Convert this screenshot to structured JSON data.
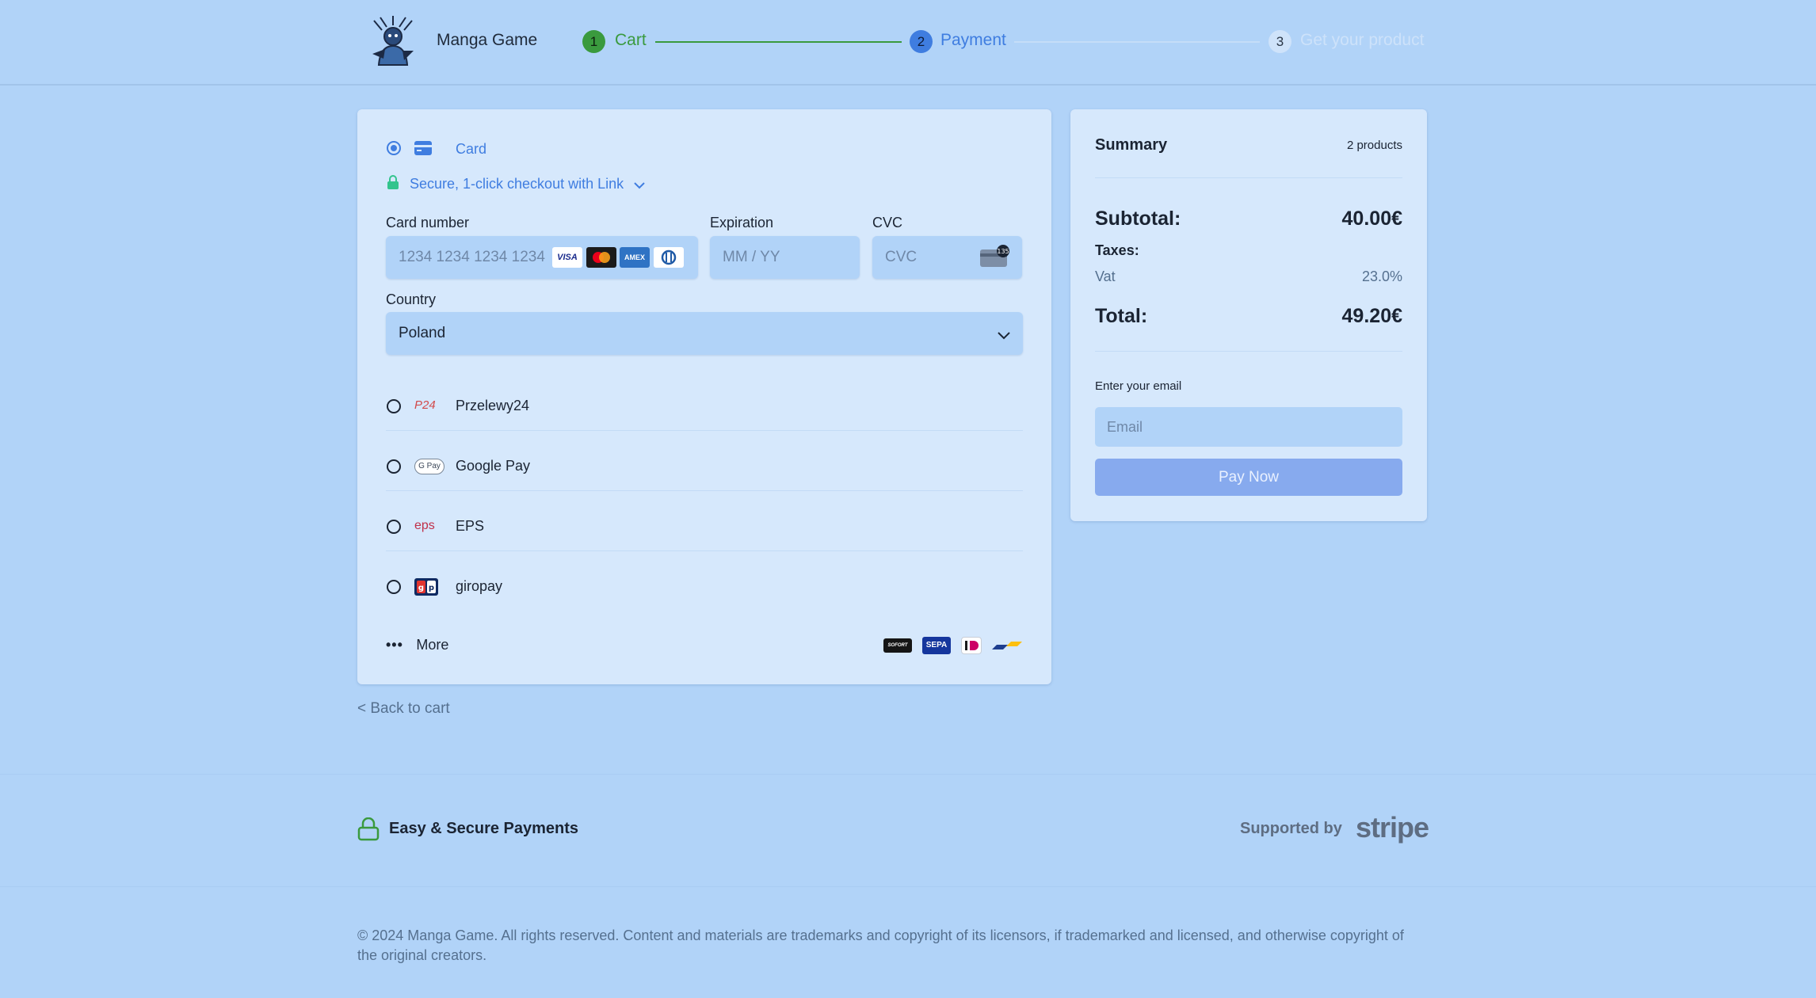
{
  "header": {
    "brand": "Manga Game",
    "steps": [
      {
        "number": "1",
        "label": "Cart",
        "color": "#3a9a3e"
      },
      {
        "number": "2",
        "label": "Payment",
        "color": "#3f7de0"
      },
      {
        "number": "3",
        "label": "Get your product",
        "color": "#d2e5fb"
      }
    ]
  },
  "payment": {
    "card_method_label": "Card",
    "link_text": "Secure, 1-click checkout with Link",
    "card_number_label": "Card number",
    "card_number_placeholder": "1234 1234 1234 1234",
    "card_brands": [
      "VISA",
      "MC",
      "AMEX",
      "DINERS"
    ],
    "expiration_label": "Expiration",
    "expiration_placeholder": "MM / YY",
    "cvc_label": "CVC",
    "cvc_placeholder": "CVC",
    "country_label": "Country",
    "country_value": "Poland",
    "methods": [
      {
        "label": "Przelewy24",
        "icon": "p24-icon"
      },
      {
        "label": "Google Pay",
        "icon": "gpay-icon"
      },
      {
        "label": "EPS",
        "icon": "eps-icon"
      },
      {
        "label": "giropay",
        "icon": "giropay-icon"
      }
    ],
    "more_label": "More",
    "extra_brands": [
      "SOFORT",
      "SEPA",
      "iD",
      "bancontact"
    ]
  },
  "summary": {
    "title": "Summary",
    "product_count": "2 products",
    "subtotal_label": "Subtotal:",
    "subtotal_value": "40.00€",
    "taxes_label": "Taxes:",
    "vat_label": "Vat",
    "vat_value": "23.0%",
    "total_label": "Total:",
    "total_value": "49.20€",
    "email_label": "Enter your email",
    "email_placeholder": "Email",
    "pay_button": "Pay Now"
  },
  "back_link": "< Back to cart",
  "footer": {
    "secure_text": "Easy & Secure Payments",
    "supported_by": "Supported by",
    "stripe_word": "stripe",
    "copyright": "© 2024 Manga Game. All rights reserved. Content and materials are trademarks and copyright of its licensors, if trademarked and licensed, and otherwise copyright of the original creators."
  }
}
